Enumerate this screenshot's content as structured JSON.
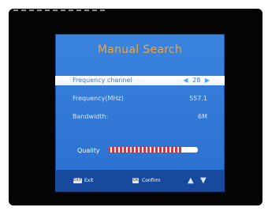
{
  "screen": {
    "title": "Manual Search"
  },
  "fields": [
    {
      "label": "Frequency channel",
      "value": "28"
    },
    {
      "label": "Frequency(MHz)",
      "value": "557.1"
    },
    {
      "label": "Bandwidth:",
      "value": "6M"
    }
  ],
  "quality": {
    "label": "Quality",
    "level_fraction": 0.82
  },
  "footer": {
    "exit_label": "Exit",
    "exit_key_label": "EXIT",
    "confirm_label": "Confirm",
    "confirm_key_label": "OK"
  },
  "icons": {
    "left": "left-arrow-icon",
    "right": "right-arrow-icon",
    "up_down": "up-down-arrows-icon"
  },
  "colors": {
    "panel": "#2f79d6",
    "title": "#f2a53a",
    "selected_row": "#ffffff",
    "quality_fill": "#d8333f",
    "footer": "#174a9c"
  }
}
